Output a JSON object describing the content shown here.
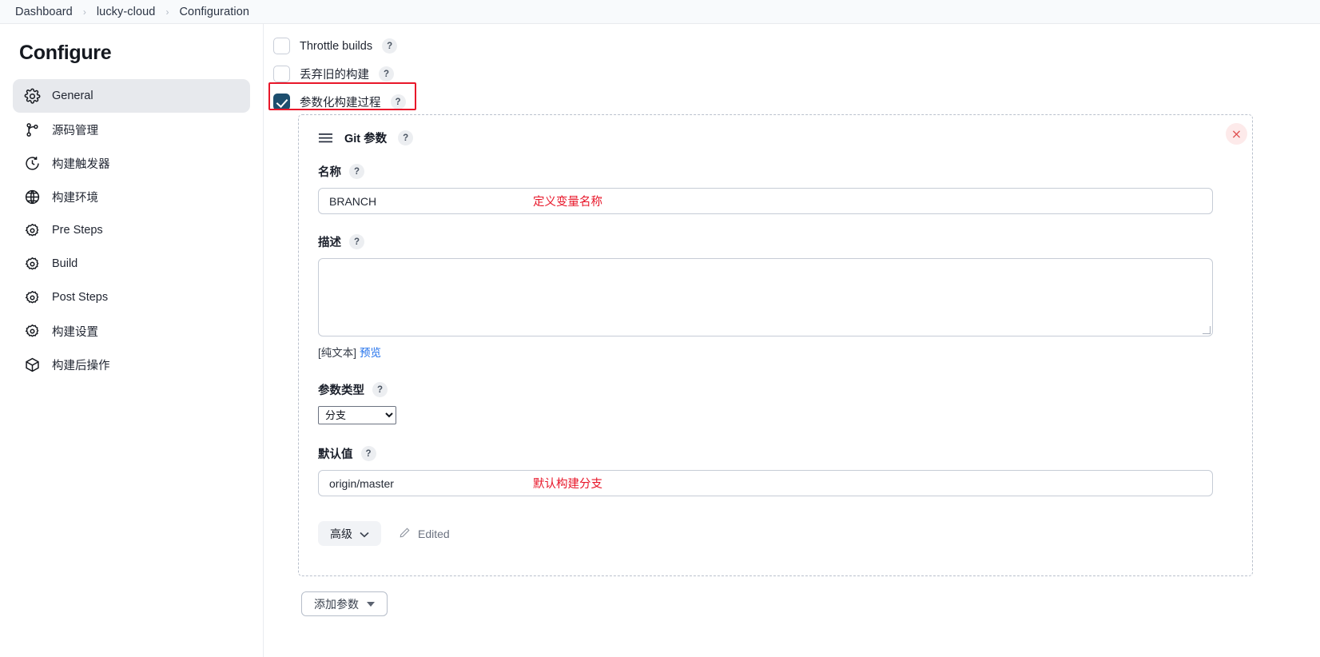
{
  "breadcrumb": {
    "items": [
      "Dashboard",
      "lucky-cloud",
      "Configuration"
    ],
    "separator": "›"
  },
  "sidebar": {
    "title": "Configure",
    "items": [
      {
        "label": "General",
        "icon": "gear-icon",
        "active": true
      },
      {
        "label": "源码管理",
        "icon": "branch-icon",
        "active": false
      },
      {
        "label": "构建触发器",
        "icon": "clock-icon",
        "active": false
      },
      {
        "label": "构建环境",
        "icon": "globe-icon",
        "active": false
      },
      {
        "label": "Pre Steps",
        "icon": "gear-icon",
        "active": false
      },
      {
        "label": "Build",
        "icon": "gear-icon",
        "active": false
      },
      {
        "label": "Post Steps",
        "icon": "gear-icon",
        "active": false
      },
      {
        "label": "构建设置",
        "icon": "gear-icon",
        "active": false
      },
      {
        "label": "构建后操作",
        "icon": "package-icon",
        "active": false
      }
    ]
  },
  "main": {
    "checkboxes": [
      {
        "label": "Throttle builds",
        "checked": false,
        "help": "?"
      },
      {
        "label": "丢弃旧的构建",
        "checked": false,
        "help": "?"
      },
      {
        "label": "参数化构建过程",
        "checked": true,
        "help": "?",
        "highlighted": true
      }
    ],
    "highlight_color": "#e8172a",
    "param_panel": {
      "drag_handle": "hamburger-icon",
      "title": "Git 参数",
      "title_help": "?",
      "close_label": "×",
      "fields": {
        "name": {
          "label": "名称",
          "help": "?",
          "value": "BRANCH",
          "annotation": "定义变量名称"
        },
        "description": {
          "label": "描述",
          "help": "?",
          "value": "",
          "footer_text": "[纯文本]",
          "footer_link": "预览"
        },
        "param_type": {
          "label": "参数类型",
          "help": "?",
          "selected": "分支",
          "options": [
            "分支"
          ]
        },
        "default_value": {
          "label": "默认值",
          "help": "?",
          "value": "origin/master",
          "annotation": "默认构建分支"
        }
      },
      "advanced_button": "高级",
      "edited_label": "Edited"
    },
    "add_param_button": "添加参数"
  }
}
